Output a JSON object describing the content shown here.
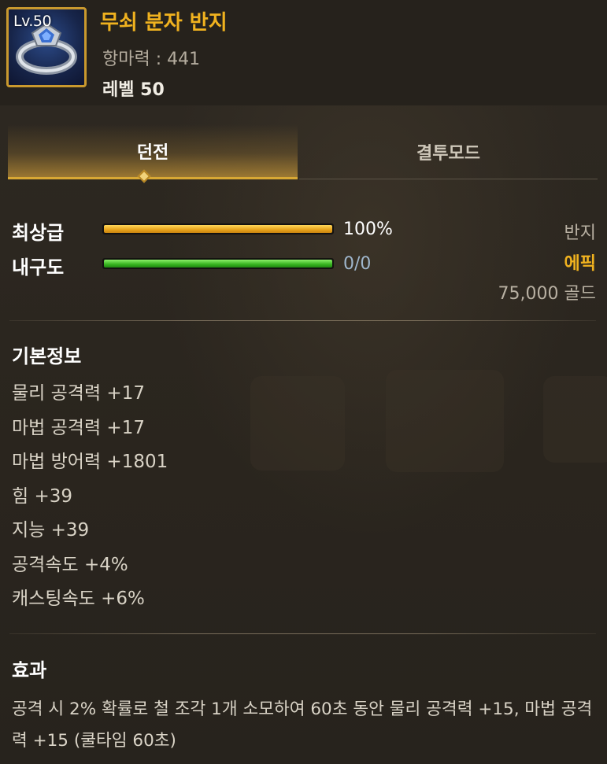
{
  "item": {
    "level_badge": "Lv.50",
    "name": "무쇠 분자 반지",
    "magic_resist": "항마력 : 441",
    "level": "레벨 50",
    "icon": "ring-icon"
  },
  "tabs": [
    {
      "label": "던전",
      "active": true
    },
    {
      "label": "결투모드",
      "active": false
    }
  ],
  "grade": {
    "label": "최상급",
    "value": "100%",
    "fill": 1.0
  },
  "durability": {
    "label": "내구도",
    "value": "0/0",
    "fill": 1.0
  },
  "info": {
    "type": "반지",
    "rarity": "에픽",
    "price": "75,000 골드"
  },
  "basic": {
    "title": "기본정보",
    "stats": [
      "물리 공격력 +17",
      "마법 공격력 +17",
      "마법 방어력 +1801",
      "힘 +39",
      "지능 +39",
      "공격속도 +4%",
      "캐스팅속도 +6%"
    ]
  },
  "effect": {
    "title": "효과",
    "text": "공격 시 2% 확률로 철 조각 1개 소모하여 60초 동안 물리 공격력 +15, 마법 공격력 +15 (쿨타임 60초)"
  },
  "colors": {
    "accent": "#f0b21f",
    "background": "#2b261f",
    "grade_bar": "#e7a21a",
    "durability_bar": "#37b31f"
  }
}
